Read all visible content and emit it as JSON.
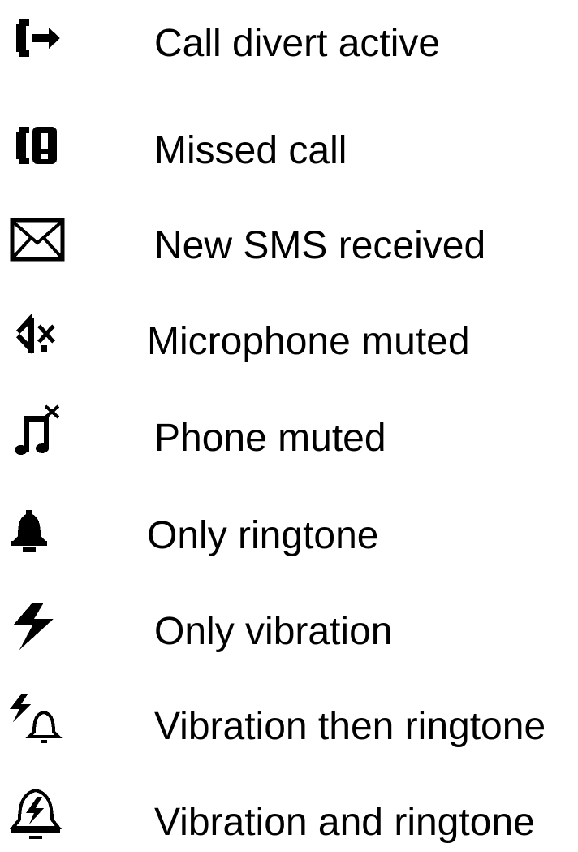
{
  "legend": {
    "items": [
      {
        "icon": "call-divert-icon",
        "label": "Call divert active"
      },
      {
        "icon": "missed-call-icon",
        "label": "Missed call"
      },
      {
        "icon": "envelope-icon",
        "label": "New SMS received"
      },
      {
        "icon": "microphone-muted-icon",
        "label": "Microphone muted"
      },
      {
        "icon": "phone-muted-icon",
        "label": "Phone muted"
      },
      {
        "icon": "bell-icon",
        "label": "Only ringtone"
      },
      {
        "icon": "lightning-icon",
        "label": "Only vibration"
      },
      {
        "icon": "vibration-then-ringtone-icon",
        "label": "Vibration then ringtone"
      },
      {
        "icon": "vibration-and-ringtone-icon",
        "label": "Vibration and ringtone"
      }
    ]
  }
}
